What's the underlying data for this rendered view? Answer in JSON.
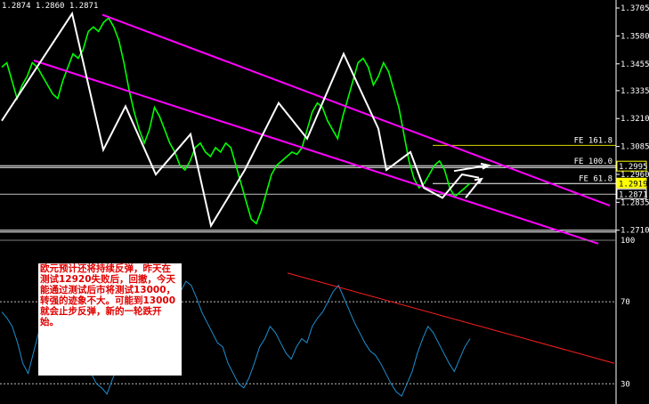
{
  "header": {
    "ohlc": "1.2874 1.2860 1.2871"
  },
  "note": {
    "text": "欧元预计还将持续反弹，昨天在测试12920失败后，回撤，今天能通过测试后市将测试13000，转强的迹象不大。可能到13000就会止步反弹，新的一轮跌开始。"
  },
  "colors": {
    "background": "#000000",
    "price": "#00ff00",
    "zigzag": "#ffffff",
    "channel": "#ff00ff",
    "indicator": "#1e8fd0",
    "trendline": "#ff2020",
    "fib161": "#d8d800",
    "fib100": "#ffffff",
    "fib618": "#ffffff",
    "price_tag_bg": "#ffff00",
    "axis": "#ffffff"
  },
  "chart_data": [
    {
      "type": "line",
      "panel": "price",
      "y_ticks": [
        "1.3705",
        "1.3580",
        "1.3455",
        "1.3335",
        "1.3210",
        "1.3085",
        "1.2960",
        "1.2835",
        "1.2710"
      ],
      "ylim": [
        1.2665,
        1.3725
      ],
      "price_tags": [
        {
          "label": "1.2995",
          "value": 1.2995,
          "style": "bordered"
        },
        {
          "label": "1.2919",
          "value": 1.2919,
          "style": "filled"
        },
        {
          "label": "1.2871",
          "value": 1.2871,
          "style": "outline"
        }
      ],
      "fib_levels": [
        {
          "label": "FE 161.8",
          "value": 1.309
        },
        {
          "label": "FE 100.0",
          "value": 1.2995
        },
        {
          "label": "FE 61.8",
          "value": 1.2919
        }
      ],
      "extra_lines": [
        1.271,
        1.2871
      ],
      "series": [
        {
          "values": [
            1.344,
            1.346,
            1.338,
            1.33,
            1.336,
            1.34,
            1.346,
            1.344,
            1.34,
            1.336,
            1.332,
            1.33,
            1.338,
            1.344,
            1.35,
            1.348,
            1.352,
            1.36,
            1.362,
            1.36,
            1.364,
            1.366,
            1.362,
            1.356,
            1.346,
            1.334,
            1.324,
            1.316,
            1.31,
            1.316,
            1.326,
            1.322,
            1.316,
            1.31,
            1.306,
            1.3,
            1.298,
            1.302,
            1.308,
            1.31,
            1.306,
            1.304,
            1.308,
            1.306,
            1.31,
            1.308,
            1.3,
            1.292,
            1.284,
            1.276,
            1.274,
            1.28,
            1.288,
            1.296,
            1.3,
            1.302,
            1.304,
            1.306,
            1.305,
            1.308,
            1.316,
            1.324,
            1.328,
            1.326,
            1.32,
            1.316,
            1.312,
            1.322,
            1.33,
            1.338,
            1.346,
            1.348,
            1.344,
            1.336,
            1.34,
            1.346,
            1.342,
            1.334,
            1.326,
            1.314,
            1.302,
            1.294,
            1.29,
            1.292,
            1.296,
            1.3,
            1.302,
            1.298,
            1.29,
            1.286,
            1.288,
            1.29,
            1.292
          ]
        },
        {
          "name": "zigzag",
          "points": [
            [
              0.0,
              1.32
            ],
            [
              0.079,
              1.368
            ],
            [
              0.114,
              1.307
            ],
            [
              0.139,
              1.3265
            ],
            [
              0.173,
              1.296
            ],
            [
              0.212,
              1.314
            ],
            [
              0.235,
              1.273
            ],
            [
              0.273,
              1.298
            ],
            [
              0.311,
              1.328
            ],
            [
              0.343,
              1.312
            ],
            [
              0.384,
              1.35
            ],
            [
              0.423,
              1.3165
            ],
            [
              0.432,
              1.298
            ],
            [
              0.459,
              1.306
            ],
            [
              0.474,
              1.29
            ],
            [
              0.495,
              1.2855
            ],
            [
              0.517,
              1.296
            ],
            [
              0.536,
              1.2945
            ]
          ]
        }
      ]
    },
    {
      "type": "line",
      "panel": "indicator",
      "y_ticks": [
        "100",
        "70",
        "30"
      ],
      "ylim": [
        21,
        100
      ],
      "levels": [
        70,
        30
      ],
      "series": [
        {
          "values": [
            65,
            62,
            58,
            50,
            40,
            35,
            45,
            55,
            60,
            48,
            40,
            52,
            58,
            55,
            50,
            45,
            40,
            35,
            30,
            28,
            25,
            32,
            38,
            45,
            50,
            55,
            60,
            58,
            50,
            55,
            62,
            68,
            72,
            70,
            75,
            80,
            78,
            72,
            65,
            60,
            55,
            50,
            48,
            40,
            35,
            30,
            28,
            33,
            40,
            48,
            52,
            58,
            55,
            50,
            45,
            42,
            48,
            52,
            50,
            58,
            62,
            65,
            70,
            75,
            78,
            72,
            66,
            60,
            55,
            50,
            46,
            44,
            40,
            35,
            30,
            26,
            24,
            30,
            36,
            45,
            52,
            58,
            55,
            50,
            45,
            40,
            36,
            42,
            48,
            52
          ]
        }
      ]
    }
  ]
}
